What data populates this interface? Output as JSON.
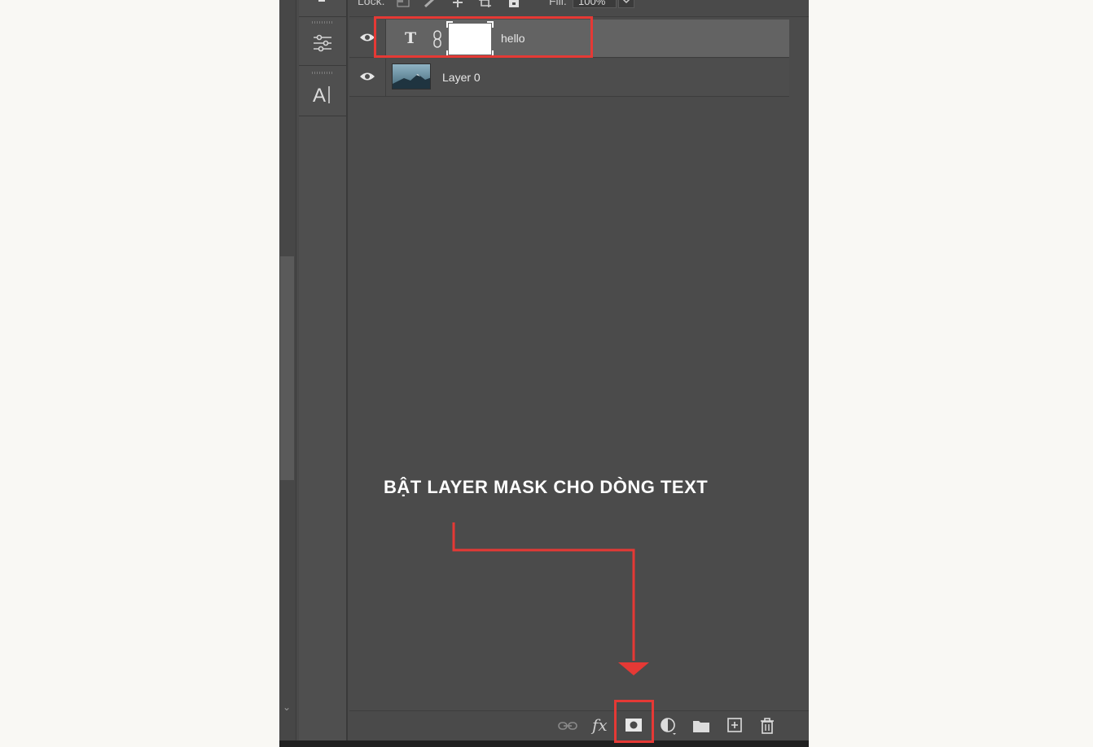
{
  "lock_bar": {
    "lock_label": "Lock:",
    "fill_label": "Fill:",
    "fill_value": "100%"
  },
  "layers": [
    {
      "name": "hello",
      "type": "text",
      "has_mask": true,
      "selected": true
    },
    {
      "name": "Layer 0",
      "type": "image",
      "selected": false
    }
  ],
  "annotation": {
    "text": "BẬT LAYER MASK CHO DÒNG TEXT",
    "color": "#ffffff"
  },
  "highlight_color": "#e53935",
  "tools": [
    "adjustments-icon",
    "character-icon"
  ],
  "bottom_bar": {
    "buttons": [
      "link-layers-icon",
      "fx-icon",
      "add-layer-mask-icon",
      "adjustment-layer-icon",
      "group-folder-icon",
      "new-layer-icon",
      "delete-layer-icon"
    ],
    "fx_label": "fx"
  }
}
